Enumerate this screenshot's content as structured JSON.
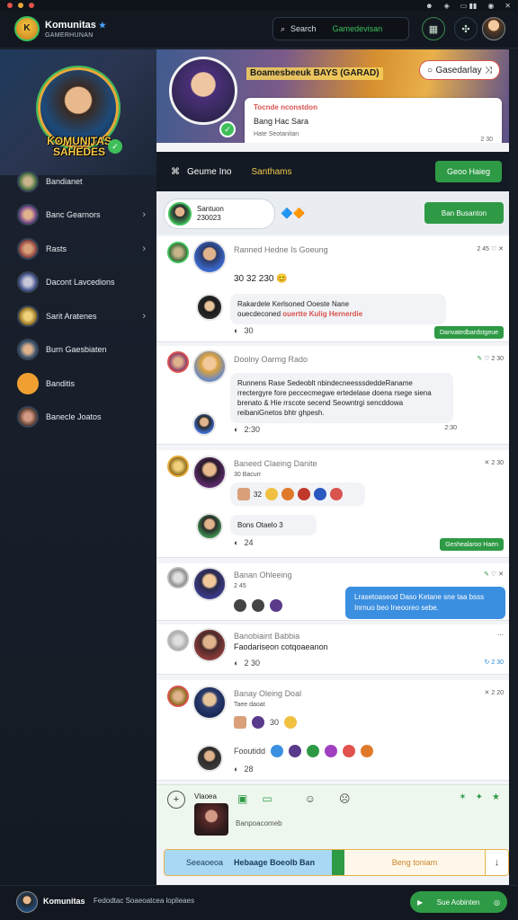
{
  "header": {
    "brand": "Komunitas",
    "brand_sub": "GAMERHUNAN",
    "search_placeholder": "Search",
    "search_accent": "Gamedevisan"
  },
  "sidebar": {
    "title": "KOMUNITAS SAHEDES",
    "items": [
      {
        "label": "Bandianet",
        "chevron": false
      },
      {
        "label": "Banc Gearnors",
        "chevron": true
      },
      {
        "label": "Rasts",
        "chevron": true
      },
      {
        "label": "Dacont Lavcedions",
        "chevron": false
      },
      {
        "label": "Sarit Aratenes",
        "chevron": true
      },
      {
        "label": "Burn Gaesbiaten",
        "chevron": false
      },
      {
        "label": "Banditis",
        "chevron": false
      },
      {
        "label": "Banecle Joatos",
        "chevron": false
      }
    ]
  },
  "banner": {
    "headline": "Boamesbeeuk BAYS (GARAD)",
    "pill": "Gasedarlay",
    "card_title": "Tocnde nconstdon",
    "card_line": "Bang Hac Sara",
    "card_meta": "Hate Seotanitan",
    "card_time": "2 30"
  },
  "tabs": {
    "active": "Geume Ino",
    "second": "Santhams",
    "button": "Geoo Haieg"
  },
  "composer_top": {
    "name": "Santuon",
    "sub": "230023",
    "button": "Ban Busanton"
  },
  "posts": [
    {
      "name": "Ranned Hedne",
      "sub": "Is Goeung",
      "time": "2 45",
      "line": "30  32  230",
      "bubble": "Rakardele Kerlsoned Ooeste Nane",
      "bubble_hl": "ouertte Kulig Hernerdie",
      "bubble_pre": "ouecdeconed",
      "react": "30",
      "pill": "Danvatedbardstgeue"
    },
    {
      "name": "Doolny Oarmg",
      "sub": "Rado",
      "time": "2 30",
      "body": "Runnens Rase Sedeoblt nbindecneesssdeddeRaname rrectergyre fore peccecmegwe ertedelase doena rsege siena brenato & Hie rrscote secend Seowntrgi sencddowa reibaniGnetos bhtr ghpesh.",
      "react": "2:30",
      "react_r": "2:30"
    },
    {
      "name": "Baneed Claeing",
      "sub": "Danite",
      "time": "2 30",
      "line": "30  Bacurr",
      "reactions_count": "32",
      "second_line": "Bons Otaelo 3",
      "react": "24",
      "pill": "Geshealaroo Haen"
    },
    {
      "name": "Banan Ohleeing",
      "sub": "2 45",
      "time": "",
      "bubble_blue": "Lrasetoaseod Daso Ketane sne taa bsss Inrnuo beo Ineooreo sebe.",
      "react": ""
    },
    {
      "name": "Banobiaint",
      "sub": "Babbia",
      "time": "",
      "line": "Faodariseon cotqoaeanon",
      "react": "2 30",
      "react_r": "2 30"
    },
    {
      "name": "Banay Oleing",
      "sub": "Doal",
      "time": "2 20",
      "line": "Taee daoat",
      "line2": "30",
      "second_line": "Fooutidd",
      "react": "28"
    }
  ],
  "composer": {
    "label": "Vlaoea",
    "sub": "Banpoacomeb"
  },
  "sendbar": {
    "left": "Seeaoeoa",
    "left2": "Hebaage Boeolb Ban",
    "right": "Beng toniam"
  },
  "footer": {
    "name": "Komunitas",
    "desc": "Fedodtac Soaeoatcea loplieaes",
    "button": "Sue Aobinten"
  },
  "colors": {
    "accent": "#2e9a45",
    "gold": "#f7c948",
    "link": "#3b8fe0",
    "alert": "#d9534f"
  }
}
